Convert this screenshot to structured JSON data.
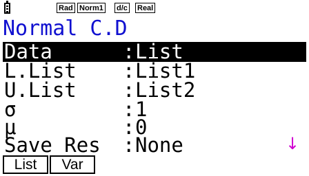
{
  "status_bar": {
    "battery_icon": "battery-icon",
    "badges": [
      "Rad",
      "Norm1",
      "d/c",
      "Real"
    ]
  },
  "title": "Normal C.D",
  "rows": [
    {
      "label": "Data",
      "value": "List",
      "selected": true
    },
    {
      "label": "L.List",
      "value": "List1",
      "selected": false
    },
    {
      "label": "U.List",
      "value": "List2",
      "selected": false
    },
    {
      "label": "σ",
      "value": "1",
      "selected": false
    },
    {
      "label": "μ",
      "value": "0",
      "selected": false
    },
    {
      "label": "Save Res",
      "value": "None",
      "selected": false
    }
  ],
  "colon": ":",
  "scroll_indicator": "↓",
  "function_keys": [
    "List",
    "Var"
  ],
  "colors": {
    "title": "#1010d0",
    "scroll_arrow": "#d000d0",
    "selection_bg": "#000000",
    "selection_fg": "#ffffff"
  }
}
